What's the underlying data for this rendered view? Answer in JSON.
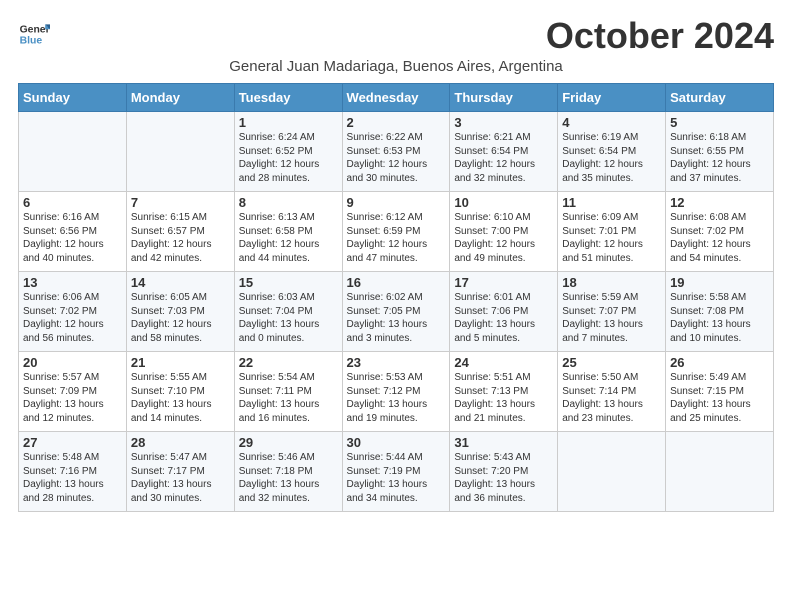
{
  "header": {
    "logo_line1": "General",
    "logo_line2": "Blue",
    "month": "October 2024",
    "location": "General Juan Madariaga, Buenos Aires, Argentina"
  },
  "weekdays": [
    "Sunday",
    "Monday",
    "Tuesday",
    "Wednesday",
    "Thursday",
    "Friday",
    "Saturday"
  ],
  "weeks": [
    [
      {
        "day": "",
        "info": ""
      },
      {
        "day": "",
        "info": ""
      },
      {
        "day": "1",
        "info": "Sunrise: 6:24 AM\nSunset: 6:52 PM\nDaylight: 12 hours\nand 28 minutes."
      },
      {
        "day": "2",
        "info": "Sunrise: 6:22 AM\nSunset: 6:53 PM\nDaylight: 12 hours\nand 30 minutes."
      },
      {
        "day": "3",
        "info": "Sunrise: 6:21 AM\nSunset: 6:54 PM\nDaylight: 12 hours\nand 32 minutes."
      },
      {
        "day": "4",
        "info": "Sunrise: 6:19 AM\nSunset: 6:54 PM\nDaylight: 12 hours\nand 35 minutes."
      },
      {
        "day": "5",
        "info": "Sunrise: 6:18 AM\nSunset: 6:55 PM\nDaylight: 12 hours\nand 37 minutes."
      }
    ],
    [
      {
        "day": "6",
        "info": "Sunrise: 6:16 AM\nSunset: 6:56 PM\nDaylight: 12 hours\nand 40 minutes."
      },
      {
        "day": "7",
        "info": "Sunrise: 6:15 AM\nSunset: 6:57 PM\nDaylight: 12 hours\nand 42 minutes."
      },
      {
        "day": "8",
        "info": "Sunrise: 6:13 AM\nSunset: 6:58 PM\nDaylight: 12 hours\nand 44 minutes."
      },
      {
        "day": "9",
        "info": "Sunrise: 6:12 AM\nSunset: 6:59 PM\nDaylight: 12 hours\nand 47 minutes."
      },
      {
        "day": "10",
        "info": "Sunrise: 6:10 AM\nSunset: 7:00 PM\nDaylight: 12 hours\nand 49 minutes."
      },
      {
        "day": "11",
        "info": "Sunrise: 6:09 AM\nSunset: 7:01 PM\nDaylight: 12 hours\nand 51 minutes."
      },
      {
        "day": "12",
        "info": "Sunrise: 6:08 AM\nSunset: 7:02 PM\nDaylight: 12 hours\nand 54 minutes."
      }
    ],
    [
      {
        "day": "13",
        "info": "Sunrise: 6:06 AM\nSunset: 7:02 PM\nDaylight: 12 hours\nand 56 minutes."
      },
      {
        "day": "14",
        "info": "Sunrise: 6:05 AM\nSunset: 7:03 PM\nDaylight: 12 hours\nand 58 minutes."
      },
      {
        "day": "15",
        "info": "Sunrise: 6:03 AM\nSunset: 7:04 PM\nDaylight: 13 hours\nand 0 minutes."
      },
      {
        "day": "16",
        "info": "Sunrise: 6:02 AM\nSunset: 7:05 PM\nDaylight: 13 hours\nand 3 minutes."
      },
      {
        "day": "17",
        "info": "Sunrise: 6:01 AM\nSunset: 7:06 PM\nDaylight: 13 hours\nand 5 minutes."
      },
      {
        "day": "18",
        "info": "Sunrise: 5:59 AM\nSunset: 7:07 PM\nDaylight: 13 hours\nand 7 minutes."
      },
      {
        "day": "19",
        "info": "Sunrise: 5:58 AM\nSunset: 7:08 PM\nDaylight: 13 hours\nand 10 minutes."
      }
    ],
    [
      {
        "day": "20",
        "info": "Sunrise: 5:57 AM\nSunset: 7:09 PM\nDaylight: 13 hours\nand 12 minutes."
      },
      {
        "day": "21",
        "info": "Sunrise: 5:55 AM\nSunset: 7:10 PM\nDaylight: 13 hours\nand 14 minutes."
      },
      {
        "day": "22",
        "info": "Sunrise: 5:54 AM\nSunset: 7:11 PM\nDaylight: 13 hours\nand 16 minutes."
      },
      {
        "day": "23",
        "info": "Sunrise: 5:53 AM\nSunset: 7:12 PM\nDaylight: 13 hours\nand 19 minutes."
      },
      {
        "day": "24",
        "info": "Sunrise: 5:51 AM\nSunset: 7:13 PM\nDaylight: 13 hours\nand 21 minutes."
      },
      {
        "day": "25",
        "info": "Sunrise: 5:50 AM\nSunset: 7:14 PM\nDaylight: 13 hours\nand 23 minutes."
      },
      {
        "day": "26",
        "info": "Sunrise: 5:49 AM\nSunset: 7:15 PM\nDaylight: 13 hours\nand 25 minutes."
      }
    ],
    [
      {
        "day": "27",
        "info": "Sunrise: 5:48 AM\nSunset: 7:16 PM\nDaylight: 13 hours\nand 28 minutes."
      },
      {
        "day": "28",
        "info": "Sunrise: 5:47 AM\nSunset: 7:17 PM\nDaylight: 13 hours\nand 30 minutes."
      },
      {
        "day": "29",
        "info": "Sunrise: 5:46 AM\nSunset: 7:18 PM\nDaylight: 13 hours\nand 32 minutes."
      },
      {
        "day": "30",
        "info": "Sunrise: 5:44 AM\nSunset: 7:19 PM\nDaylight: 13 hours\nand 34 minutes."
      },
      {
        "day": "31",
        "info": "Sunrise: 5:43 AM\nSunset: 7:20 PM\nDaylight: 13 hours\nand 36 minutes."
      },
      {
        "day": "",
        "info": ""
      },
      {
        "day": "",
        "info": ""
      }
    ]
  ]
}
